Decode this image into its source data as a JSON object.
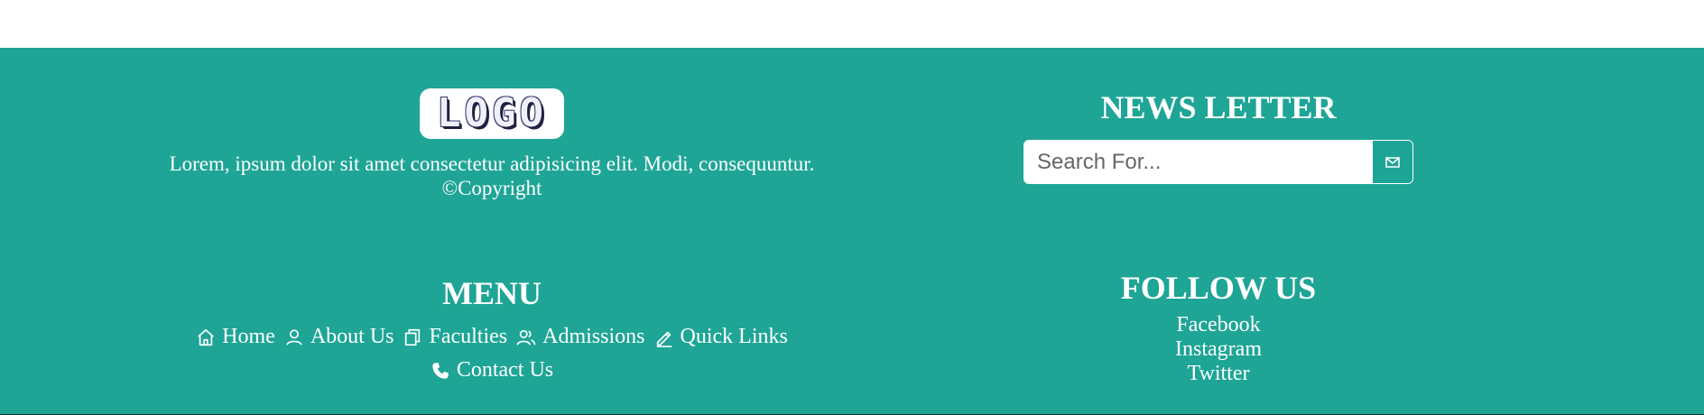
{
  "footer": {
    "logo_text": "LOGO",
    "about": {
      "description": "Lorem, ipsum dolor sit amet consectetur adipisicing elit. Modi, consequuntur.",
      "copyright": "©Copyright"
    },
    "newsletter": {
      "heading": "NEWS LETTER",
      "input_placeholder": "Search For...",
      "button_icon": "envelope-icon"
    },
    "menu": {
      "heading": "MENU",
      "items": [
        {
          "label": "Home",
          "icon": "home-icon"
        },
        {
          "label": "About Us",
          "icon": "user-icon"
        },
        {
          "label": "Faculties",
          "icon": "copy-icon"
        },
        {
          "label": "Admissions",
          "icon": "users-icon"
        },
        {
          "label": "Quick Links",
          "icon": "pencil-icon"
        },
        {
          "label": "Contact Us",
          "icon": "phone-icon"
        }
      ]
    },
    "follow": {
      "heading": "FOLLOW US",
      "links": [
        "Facebook",
        "Instagram",
        "Twitter"
      ]
    },
    "colors": {
      "background": "#1ea596",
      "text": "#ffffff"
    }
  }
}
